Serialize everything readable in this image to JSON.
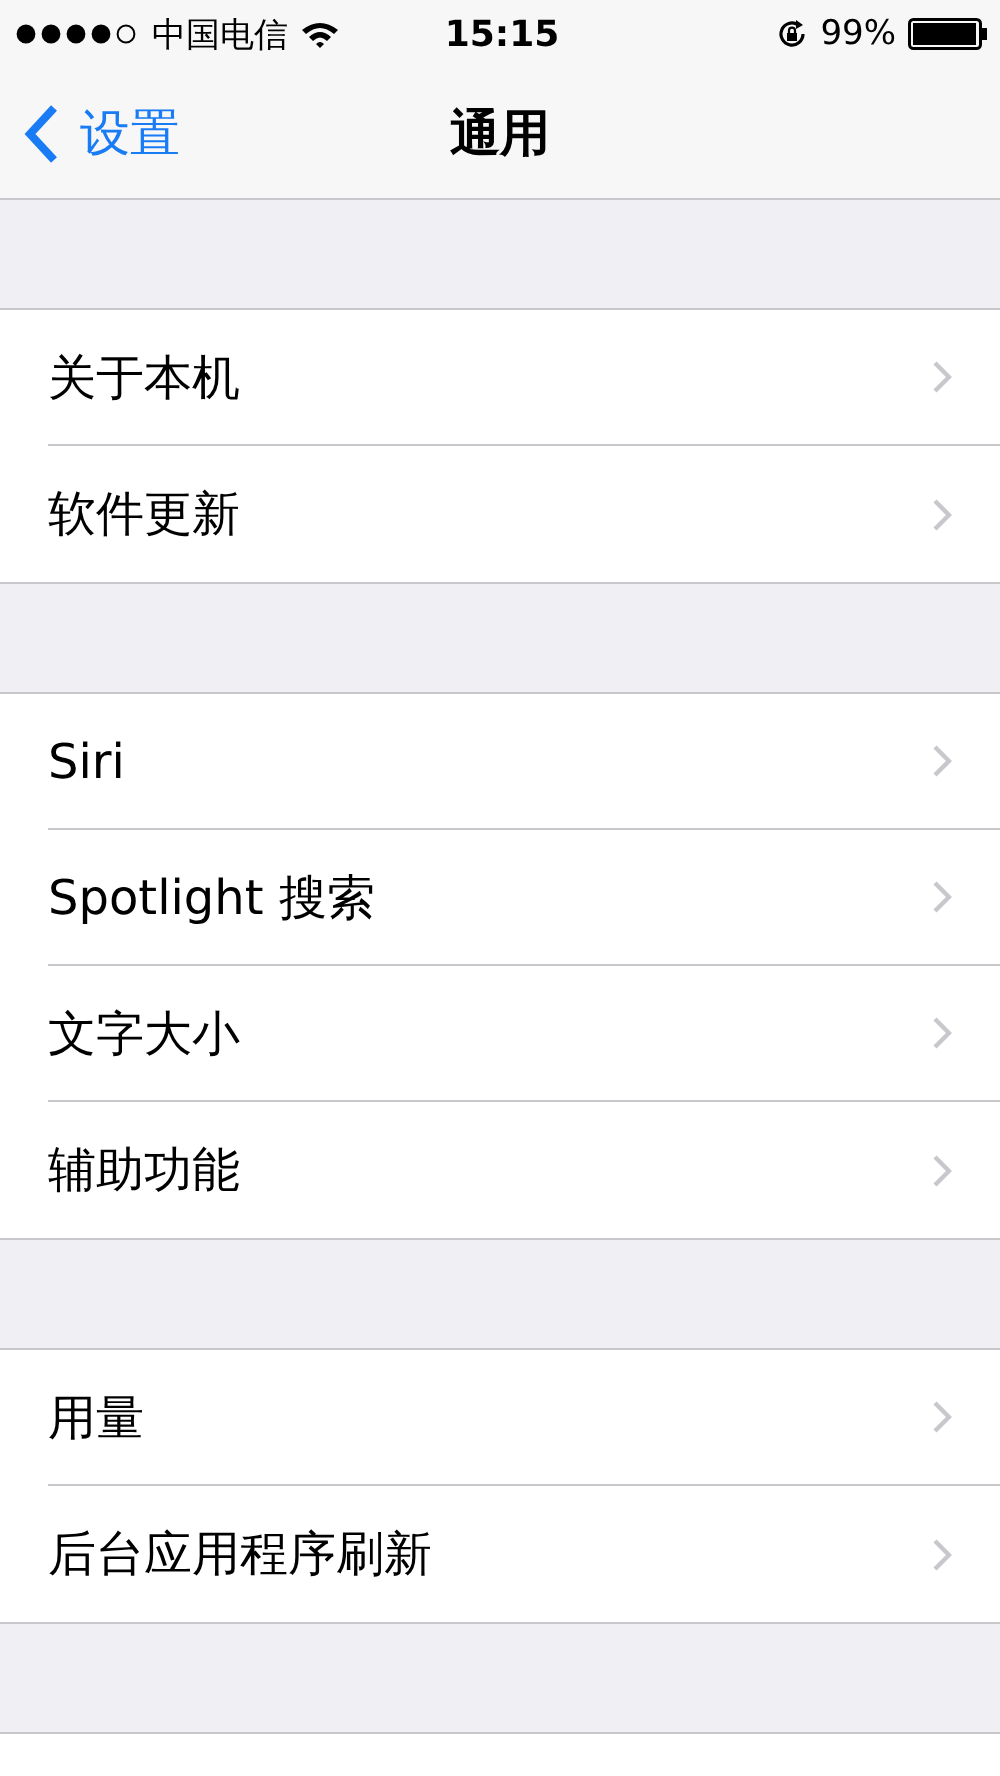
{
  "status_bar": {
    "carrier": "中国电信",
    "time": "15:15",
    "battery": "99%"
  },
  "nav": {
    "back": "设置",
    "title": "通用"
  },
  "groups": [
    {
      "items": [
        {
          "label": "关于本机"
        },
        {
          "label": "软件更新"
        }
      ]
    },
    {
      "items": [
        {
          "label": "Siri"
        },
        {
          "label": "Spotlight 搜索"
        },
        {
          "label": "文字大小"
        },
        {
          "label": "辅助功能"
        }
      ]
    },
    {
      "items": [
        {
          "label": "用量"
        },
        {
          "label": "后台应用程序刷新"
        }
      ]
    }
  ]
}
